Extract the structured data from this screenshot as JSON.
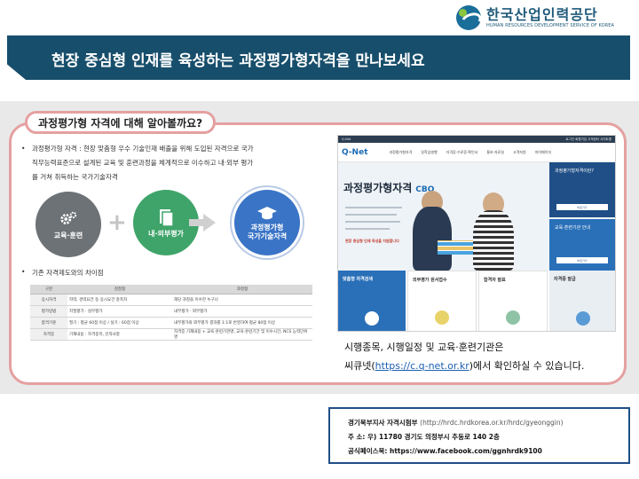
{
  "logo": {
    "name_ko": "한국산업인력공단",
    "name_en": "HUMAN RESOURCES DEVELOPMENT SERVICE OF KOREA"
  },
  "banner": {
    "title": "현장 중심형 인재를 육성하는 과정평가형자격을 만나보세요"
  },
  "section": {
    "heading": "과정평가형 자격에 대해 알아볼까요?",
    "bullet1_line1": "과정평가형 자격 : 현장 맞춤형 우수 기술인재 배출을 위해 도입된 자격으로 국가",
    "bullet1_line2": "직무능력표준으로 설계된 교육 및 훈련과정을 체계적으로 이수하고 내·외부 평가",
    "bullet1_line3": "를 거쳐 취득하는 국가기술자격",
    "bullet2": "기존 자격제도와의 차이점",
    "steps": [
      {
        "label": "교육·훈련",
        "icon": "gear-icon"
      },
      {
        "label": "내·외부평가",
        "icon": "document-icon"
      },
      {
        "label": "과정평가형\n국가기술자격",
        "icon": "graduation-cap-icon"
      }
    ],
    "plus_sign": "+"
  },
  "compare_table": {
    "headers": [
      "구분",
      "검정형",
      "과정형"
    ],
    "rows": [
      [
        "응시자격",
        "학력, 경력요건 등 응시요건 충족자",
        "해당 과정을 이수한 누구나"
      ],
      [
        "평가방법",
        "지필평가 · 실무평가",
        "내부평가 · 외부평가"
      ],
      [
        "합격기준",
        "필기 : 평균 60점 이상 / 실기 : 60점 이상",
        "내부평가와 외부평가 결과를 1:1로 반영하여 평균 80점 이상"
      ],
      [
        "자격증",
        "기재내용 : 자격종목, 인적사항",
        "자격증 기재내용 + 교육·훈련기관명, 교육·훈련기간 및 이수시간, NCS 능력단위명"
      ]
    ]
  },
  "website": {
    "top_left": "Q-Net",
    "top_links": "로그인   회원가입   고객센터   사이트맵",
    "logo": "Q-Net",
    "nav": [
      "과정평가형자격",
      "일학습병행",
      "자격증·수료증·확인서",
      "통보·자료실",
      "고객지원",
      "마이페이지"
    ],
    "hero_title": "과정평가형자격",
    "hero_badge": "CBQ",
    "hero_highlight": "현장 중심형 인재 육성을 지원합니다",
    "side1_title": "과정평가형자격이란?",
    "side1_button": "바로가기",
    "side2_title": "교육·훈련기관 안내",
    "side2_button": "바로가기",
    "cards": [
      {
        "title": "맞춤형 자격검색",
        "icon": "search-icon"
      },
      {
        "title": "외부평가 원서접수",
        "icon": "pen-icon"
      },
      {
        "title": "합격자 발표",
        "icon": "badge-icon"
      },
      {
        "title": "자격증 발급",
        "icon": "certificate-icon"
      }
    ]
  },
  "caption": {
    "line1": "시행종목, 시행일정 및 교육·훈련기관은",
    "line2_prefix": "씨큐넷(",
    "link": "https://c.q-net.or.kr",
    "line2_suffix": ")에서 확인하실 수 있습니다."
  },
  "footer": {
    "office": "경기북부지사 자격시험부",
    "office_url": "(http://hrdc.hrdkorea.or.kr/hrdc/gyeonggin)",
    "address": "주 소:  우) 11780  경기도 의정부시 추동로 140 2층",
    "facebook": "공식페이스북:  https://www.facebook.com/ggnhrdk9100"
  },
  "colors": {
    "banner": "#174e6b",
    "panel_border": "#e5a0a0",
    "band": "#e9e9ea",
    "step1": "#6d7276",
    "step2": "#3fa46a",
    "step3": "#3a74c6",
    "link": "#1b5fb0"
  }
}
